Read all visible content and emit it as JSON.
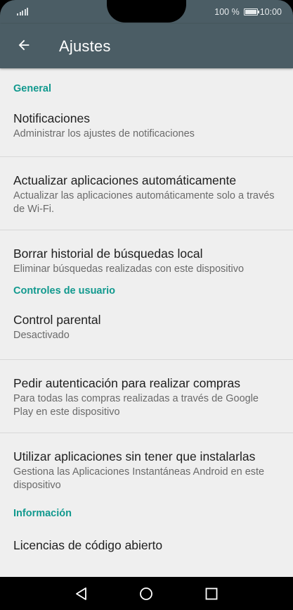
{
  "status_bar": {
    "battery_percent": "100 %",
    "time": "10:00"
  },
  "app_bar": {
    "title": "Ajustes",
    "back_icon": "arrow-back-icon"
  },
  "sections": [
    {
      "header": "General",
      "items": [
        {
          "title": "Notificaciones",
          "subtitle": "Administrar los ajustes de notificaciones"
        },
        {
          "title": "Actualizar aplicaciones automáticamente",
          "subtitle": "Actualizar las aplicaciones automáticamente solo a través de Wi-Fi."
        },
        {
          "title": "Borrar historial de búsquedas local",
          "subtitle": "Eliminar búsquedas realizadas con este dispositivo"
        }
      ]
    },
    {
      "header": "Controles de usuario",
      "items": [
        {
          "title": "Control parental",
          "subtitle": "Desactivado"
        },
        {
          "title": "Pedir autenticación para realizar compras",
          "subtitle": "Para todas las compras realizadas a través de Google Play en este dispositivo"
        },
        {
          "title": "Utilizar aplicaciones sin tener que instalarlas",
          "subtitle": "Gestiona las Aplicaciones Instantáneas Android en este dispositivo"
        }
      ]
    },
    {
      "header": "Información",
      "items": [
        {
          "title": "Licencias de código abierto"
        }
      ]
    }
  ],
  "nav_bar": {
    "back": "nav-back-icon",
    "home": "nav-home-icon",
    "recents": "nav-recents-icon"
  },
  "colors": {
    "app_bar": "#4b5d65",
    "section_header": "#11998e",
    "background": "#efefef"
  }
}
